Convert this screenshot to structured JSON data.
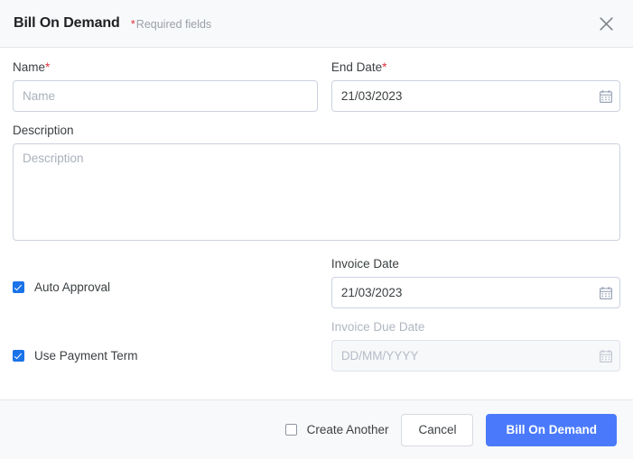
{
  "header": {
    "title": "Bill On Demand",
    "required_star": "*",
    "required_note": "Required fields",
    "close_icon": "close-icon"
  },
  "form": {
    "name": {
      "label": "Name",
      "required_mark": "*",
      "placeholder": "Name",
      "value": ""
    },
    "end_date": {
      "label": "End Date",
      "required_mark": "*",
      "value": "21/03/2023",
      "icon": "calendar-icon"
    },
    "description": {
      "label": "Description",
      "placeholder": "Description",
      "value": ""
    },
    "auto_approval": {
      "label": "Auto Approval",
      "checked": true
    },
    "use_payment_term": {
      "label": "Use Payment Term",
      "checked": true
    },
    "invoice_date": {
      "label": "Invoice Date",
      "value": "21/03/2023",
      "icon": "calendar-icon"
    },
    "invoice_due_date": {
      "label": "Invoice Due Date",
      "placeholder": "DD/MM/YYYY",
      "value": "",
      "disabled": true,
      "icon": "calendar-icon"
    }
  },
  "footer": {
    "create_another": {
      "label": "Create Another",
      "checked": false
    },
    "cancel_label": "Cancel",
    "submit_label": "Bill On Demand"
  },
  "colors": {
    "primary": "#4a7afb",
    "checkbox": "#1a73e8",
    "required_asterisk": "#e0333e",
    "header_bg": "#f8f9fb",
    "footer_bg": "#f8f9fa",
    "border": "#ccd2e0",
    "text": "#3c4043",
    "placeholder": "#aab0bc",
    "disabled_text": "#b0b6c0"
  }
}
